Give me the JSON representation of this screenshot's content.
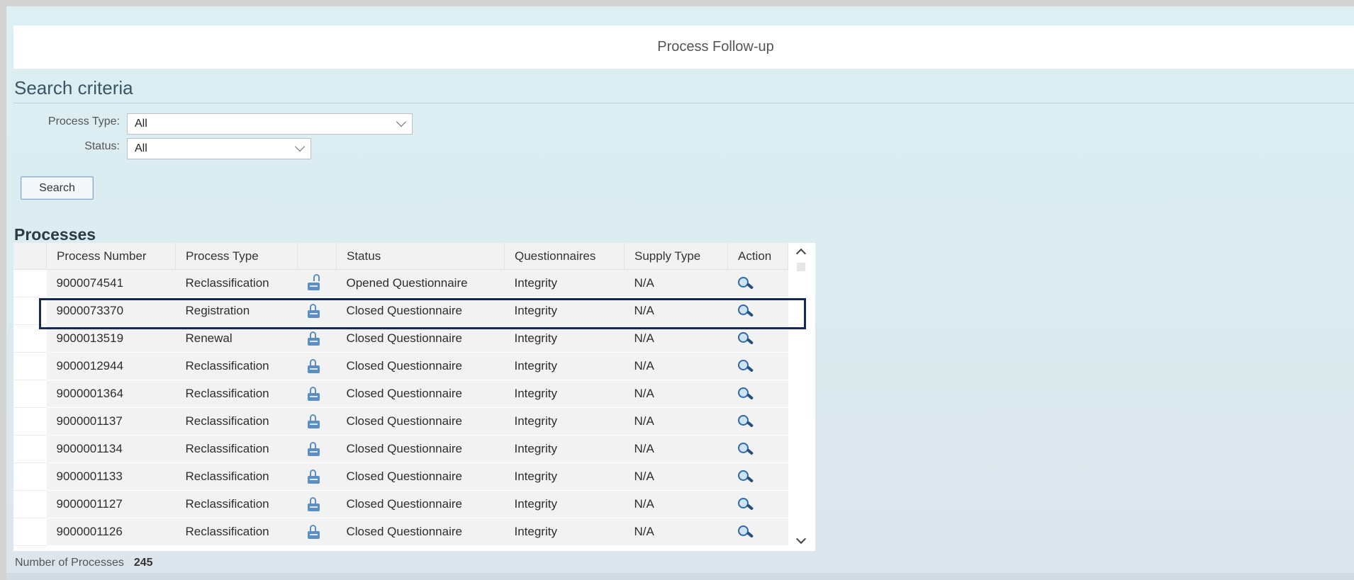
{
  "header": {
    "title": "Process Follow-up"
  },
  "search": {
    "section_title": "Search criteria",
    "process_type_label": "Process Type:",
    "process_type_value": "All",
    "status_label": "Status:",
    "status_value": "All",
    "button_label": "Search"
  },
  "processes": {
    "section_title": "Processes",
    "columns": [
      "Process Number",
      "Process Type",
      "",
      "Status",
      "Questionnaires",
      "Supply Type",
      "Action"
    ],
    "rows": [
      {
        "number": "9000074541",
        "type": "Reclassification",
        "lock": "unlocked",
        "status": "Opened Questionnaire",
        "questionnaire": "Integrity",
        "supply": "N/A"
      },
      {
        "number": "9000073370",
        "type": "Registration",
        "lock": "locked",
        "status": "Closed Questionnaire",
        "questionnaire": "Integrity",
        "supply": "N/A"
      },
      {
        "number": "9000013519",
        "type": "Renewal",
        "lock": "locked",
        "status": "Closed Questionnaire",
        "questionnaire": "Integrity",
        "supply": "N/A"
      },
      {
        "number": "9000012944",
        "type": "Reclassification",
        "lock": "locked",
        "status": "Closed Questionnaire",
        "questionnaire": "Integrity",
        "supply": "N/A"
      },
      {
        "number": "9000001364",
        "type": "Reclassification",
        "lock": "locked",
        "status": "Closed Questionnaire",
        "questionnaire": "Integrity",
        "supply": "N/A"
      },
      {
        "number": "9000001137",
        "type": "Reclassification",
        "lock": "locked",
        "status": "Closed Questionnaire",
        "questionnaire": "Integrity",
        "supply": "N/A"
      },
      {
        "number": "9000001134",
        "type": "Reclassification",
        "lock": "locked",
        "status": "Closed Questionnaire",
        "questionnaire": "Integrity",
        "supply": "N/A"
      },
      {
        "number": "9000001133",
        "type": "Reclassification",
        "lock": "locked",
        "status": "Closed Questionnaire",
        "questionnaire": "Integrity",
        "supply": "N/A"
      },
      {
        "number": "9000001127",
        "type": "Reclassification",
        "lock": "locked",
        "status": "Closed Questionnaire",
        "questionnaire": "Integrity",
        "supply": "N/A"
      },
      {
        "number": "9000001126",
        "type": "Reclassification",
        "lock": "locked",
        "status": "Closed Questionnaire",
        "questionnaire": "Integrity",
        "supply": "N/A"
      }
    ],
    "action_icon": "magnifier-icon",
    "highlighted_row": 1
  },
  "footer": {
    "count_label": "Number of Processes",
    "count_value": "245"
  }
}
